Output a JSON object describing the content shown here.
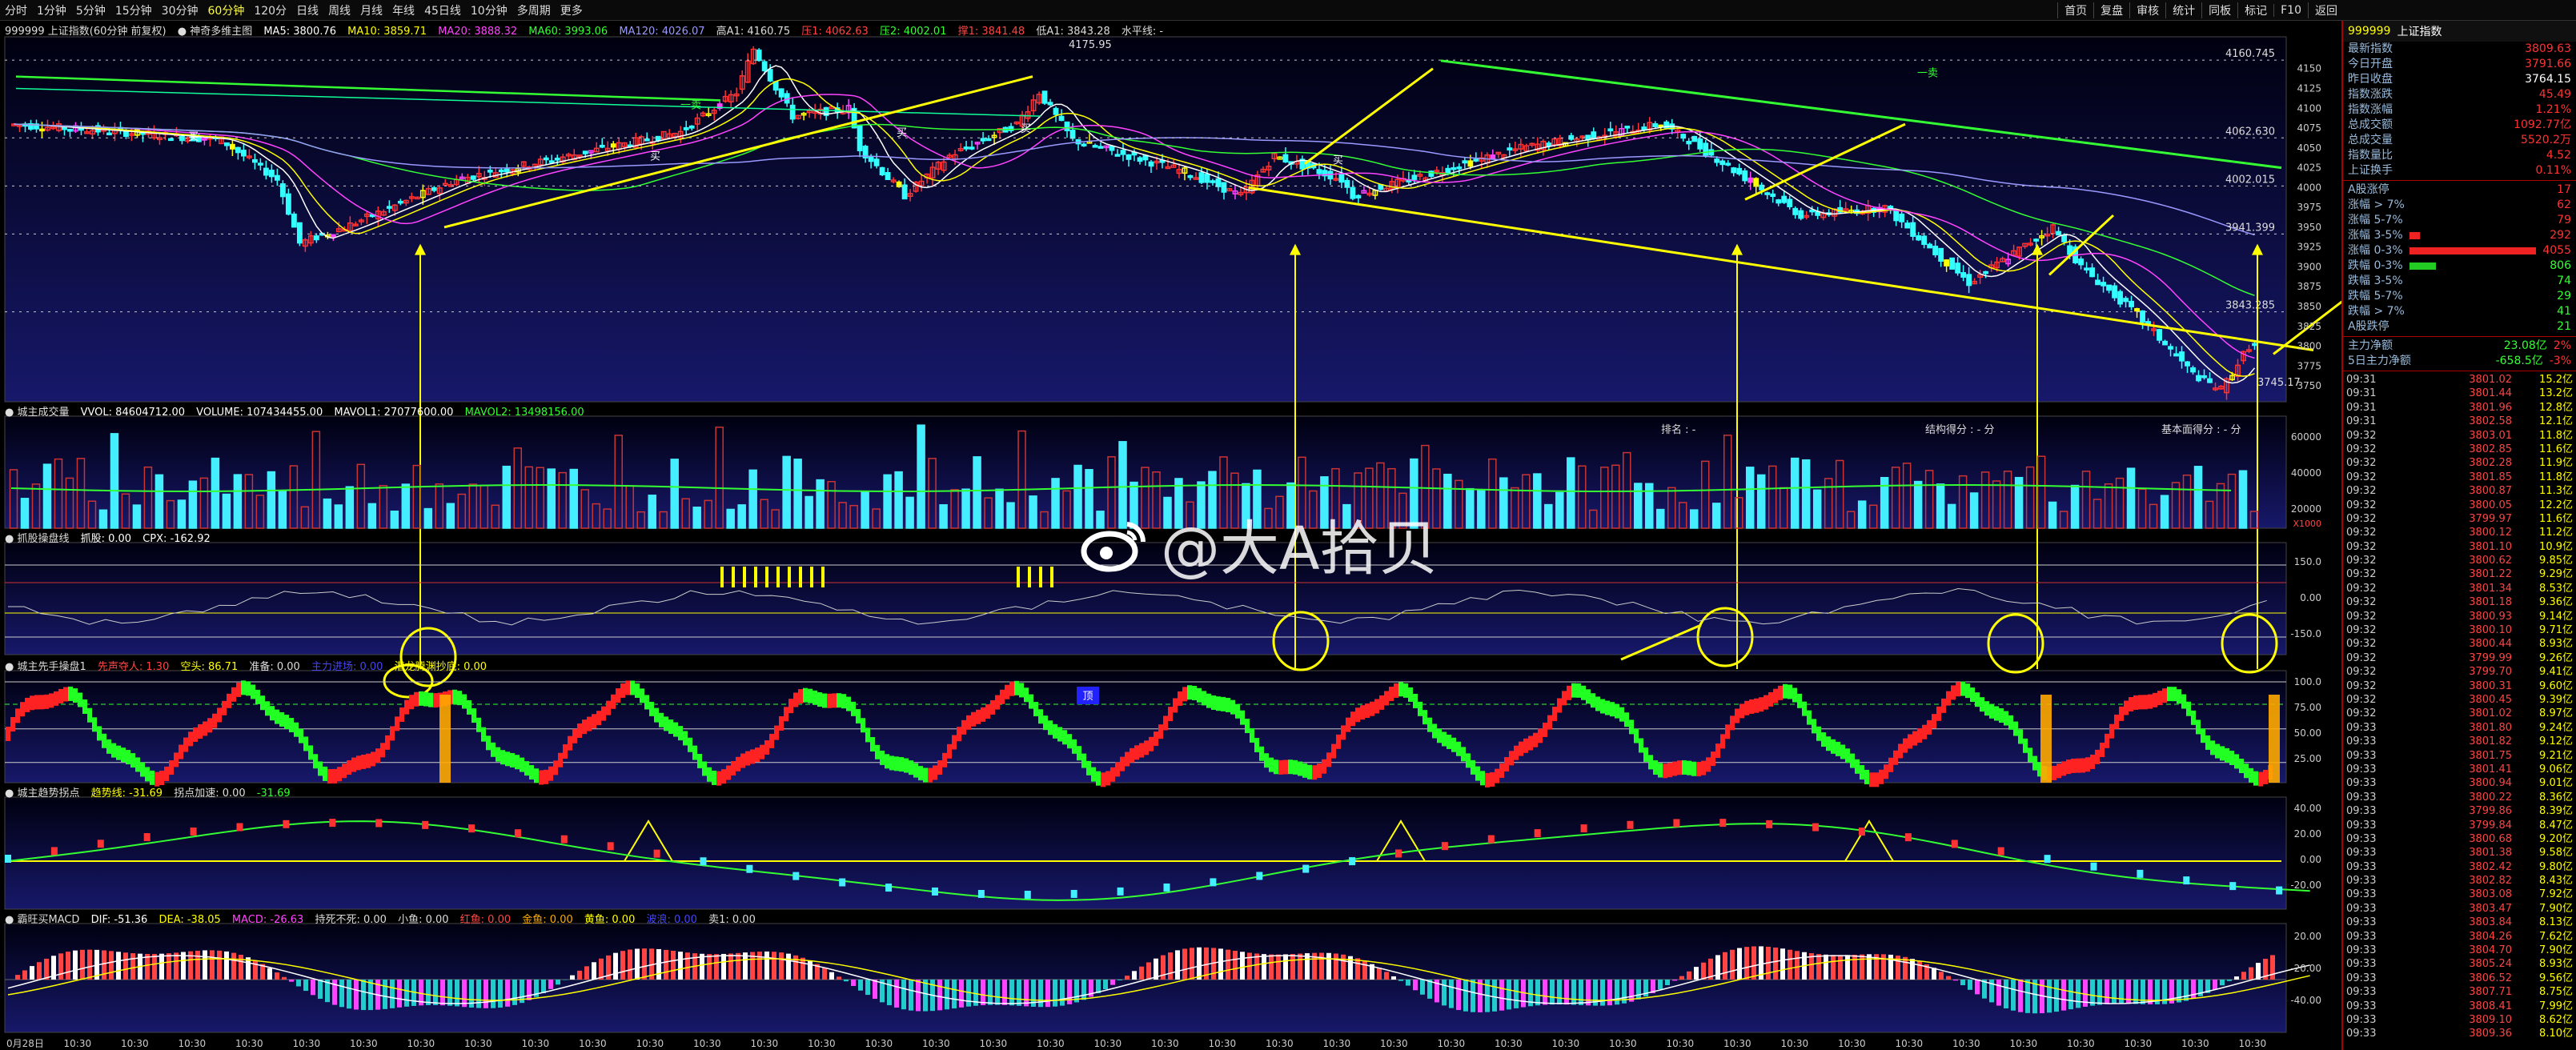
{
  "toolbar": {
    "timeframes": [
      "分时",
      "1分钟",
      "5分钟",
      "15分钟",
      "30分钟",
      "60分钟",
      "120分",
      "日线",
      "周线",
      "月线",
      "年线",
      "45日线",
      "10分钟",
      "多周期",
      "更多"
    ],
    "active_index": 5,
    "right_items": [
      "首页",
      "复盘",
      "审核",
      "统计",
      "同板",
      "标记",
      "F10",
      "返回"
    ]
  },
  "main_panel": {
    "title": "999999 上证指数(60分钟 前复权)",
    "indicator": "● 神奇多维主图",
    "ma": [
      "MA5: 3800.76",
      "MA10: 3859.71",
      "MA20: 3888.32",
      "MA60: 3993.06",
      "MA120: 4026.07"
    ],
    "extra": [
      "高A1: 4160.75",
      "压1: 4062.63",
      "压2: 4002.01",
      "撑1: 3841.48",
      "低A1: 3843.28",
      "水平线: -"
    ],
    "y_labels": [
      "4150",
      "4125",
      "4100",
      "4075",
      "4050",
      "4025",
      "4000",
      "3975",
      "3950",
      "3925",
      "3900",
      "3875",
      "3850",
      "3825",
      "3800",
      "3775",
      "3750"
    ],
    "level_labels": [
      "4160.745",
      "4062.630",
      "4002.015",
      "3941.399",
      "3843.285"
    ],
    "high_label": "4175.95",
    "low_label": "3745.17",
    "buy_label": "买",
    "sell_label": "卖",
    "markers": [
      "一卖",
      "一卖"
    ]
  },
  "volume_panel": {
    "title": "● 城主成交量",
    "values": [
      "VVOL: 84604712.00",
      "VOLUME: 107434455.00",
      "MAVOL1: 27077600.00",
      "MAVOL2: 13498156.00"
    ],
    "labels": [
      "排名 : -",
      "结构得分 : - 分",
      "基本面得分 : - 分"
    ],
    "y_labels": [
      "60000",
      "40000",
      "20000"
    ],
    "unit_label": "X1000"
  },
  "panel3": {
    "title": "● 抓股操盘线",
    "values": [
      "抓股: 0.00",
      "CPX: -162.92"
    ],
    "y_labels": [
      "150.0",
      "0.00",
      "-150.0"
    ]
  },
  "panel4": {
    "title": "● 城主先手操盘1",
    "values": [
      "先声夺人: 1.30",
      "空头: 86.71",
      "准备: 0.00",
      "主力进场: 0.00",
      "潜龙腾渊抄底: 0.00"
    ],
    "y_labels": [
      "100.0",
      "75.00",
      "50.00",
      "25.00"
    ],
    "badge": "顶"
  },
  "panel5": {
    "title": "● 城主趋势拐点",
    "values": [
      "趋势线: -31.69",
      "拐点加速: 0.00",
      "-31.69"
    ],
    "y_labels": [
      "40.00",
      "20.00",
      "0.00",
      "-20.00"
    ]
  },
  "panel6": {
    "title": "● 霸旺买MACD",
    "values": [
      "DIF: -51.36",
      "DEA: -38.05",
      "MACD: -26.63",
      "持死不死: 0.00",
      "小鱼: 0.00",
      "红鱼: 0.00",
      "金鱼: 0.00",
      "黄鱼: 0.00",
      "波浪: 0.00",
      "卖1: 0.00"
    ],
    "y_labels": [
      "20.00",
      "-20.00",
      "-40.00"
    ]
  },
  "time_axis": {
    "first": "0月28日",
    "repeat": "10:30",
    "count": 40
  },
  "watermark": "@大A拾贝",
  "quote": {
    "code": "999999",
    "name": "上证指数",
    "rows": [
      {
        "k": "最新指数",
        "v": "3809.63",
        "c": "v"
      },
      {
        "k": "今日开盘",
        "v": "3791.66",
        "c": "v"
      },
      {
        "k": "昨日收盘",
        "v": "3764.15",
        "c": "w"
      },
      {
        "k": "指数涨跌",
        "v": "45.49",
        "c": "v"
      },
      {
        "k": "指数涨幅",
        "v": "1.21%",
        "c": "v"
      },
      {
        "k": "总成交额",
        "v": "1092.77亿",
        "c": "v"
      },
      {
        "k": "总成交量",
        "v": "5520.2万",
        "c": "v"
      },
      {
        "k": "指数量比",
        "v": "4.52",
        "c": "v"
      },
      {
        "k": "上证换手",
        "v": "0.11%",
        "c": "v"
      }
    ],
    "breadth": [
      {
        "k": "A股涨停",
        "v": "17",
        "c": "v",
        "bar": 0
      },
      {
        "k": "涨幅 > 7%",
        "v": "62",
        "c": "v",
        "bar": 0
      },
      {
        "k": "涨幅 5-7%",
        "v": "79",
        "c": "v",
        "bar": 0
      },
      {
        "k": "涨幅 3-5%",
        "v": "292",
        "c": "v",
        "bar": 0.08
      },
      {
        "k": "涨幅 0-3%",
        "v": "4055",
        "c": "v",
        "bar": 1.0
      },
      {
        "k": "跌幅 0-3%",
        "v": "806",
        "c": "g",
        "bar": 0.2
      },
      {
        "k": "跌幅 3-5%",
        "v": "74",
        "c": "g",
        "bar": 0
      },
      {
        "k": "跌幅 5-7%",
        "v": "29",
        "c": "g",
        "bar": 0
      },
      {
        "k": "跌幅 > 7%",
        "v": "41",
        "c": "g",
        "bar": 0
      },
      {
        "k": "A股跌停",
        "v": "21",
        "c": "g",
        "bar": 0
      }
    ],
    "fund_rows": [
      {
        "k": "主力净额",
        "v": "23.08亿",
        "v2": "2%"
      },
      {
        "k": "5日主力净额",
        "v": "-658.5亿",
        "v2": "-3%"
      }
    ],
    "ticks": [
      [
        "09:31",
        "3801.02",
        "15.2亿"
      ],
      [
        "09:31",
        "3801.44",
        "13.2亿"
      ],
      [
        "09:31",
        "3801.96",
        "12.8亿"
      ],
      [
        "09:31",
        "3802.58",
        "12.1亿"
      ],
      [
        "09:32",
        "3803.01",
        "11.8亿"
      ],
      [
        "09:32",
        "3802.85",
        "11.6亿"
      ],
      [
        "09:32",
        "3802.28",
        "11.9亿"
      ],
      [
        "09:32",
        "3801.85",
        "11.8亿"
      ],
      [
        "09:32",
        "3800.87",
        "11.3亿"
      ],
      [
        "09:32",
        "3800.05",
        "12.2亿"
      ],
      [
        "09:32",
        "3799.97",
        "11.6亿"
      ],
      [
        "09:32",
        "3800.12",
        "11.2亿"
      ],
      [
        "09:32",
        "3801.10",
        "10.9亿"
      ],
      [
        "09:32",
        "3800.62",
        "9.85亿"
      ],
      [
        "09:32",
        "3801.22",
        "9.29亿"
      ],
      [
        "09:32",
        "3801.34",
        "8.53亿"
      ],
      [
        "09:32",
        "3801.18",
        "9.36亿"
      ],
      [
        "09:32",
        "3800.93",
        "9.14亿"
      ],
      [
        "09:32",
        "3800.10",
        "9.71亿"
      ],
      [
        "09:32",
        "3800.44",
        "8.93亿"
      ],
      [
        "09:32",
        "3799.99",
        "9.26亿"
      ],
      [
        "09:32",
        "3799.70",
        "9.41亿"
      ],
      [
        "09:32",
        "3800.31",
        "9.60亿"
      ],
      [
        "09:32",
        "3800.45",
        "9.39亿"
      ],
      [
        "09:32",
        "3801.02",
        "8.97亿"
      ],
      [
        "09:33",
        "3801.80",
        "9.24亿"
      ],
      [
        "09:33",
        "3801.82",
        "9.12亿"
      ],
      [
        "09:33",
        "3801.75",
        "9.21亿"
      ],
      [
        "09:33",
        "3801.41",
        "9.06亿"
      ],
      [
        "09:33",
        "3800.94",
        "9.01亿"
      ],
      [
        "09:33",
        "3800.22",
        "8.36亿"
      ],
      [
        "09:33",
        "3799.86",
        "8.39亿"
      ],
      [
        "09:33",
        "3799.84",
        "8.47亿"
      ],
      [
        "09:33",
        "3800.68",
        "9.20亿"
      ],
      [
        "09:33",
        "3801.38",
        "9.58亿"
      ],
      [
        "09:33",
        "3802.42",
        "9.80亿"
      ],
      [
        "09:33",
        "3802.82",
        "8.43亿"
      ],
      [
        "09:33",
        "3803.08",
        "7.92亿"
      ],
      [
        "09:33",
        "3803.47",
        "7.90亿"
      ],
      [
        "09:33",
        "3803.84",
        "8.13亿"
      ],
      [
        "09:33",
        "3804.26",
        "7.62亿"
      ],
      [
        "09:33",
        "3804.70",
        "7.90亿"
      ],
      [
        "09:33",
        "3805.24",
        "8.93亿"
      ],
      [
        "09:33",
        "3806.52",
        "9.56亿"
      ],
      [
        "09:33",
        "3807.71",
        "8.75亿"
      ],
      [
        "09:33",
        "3808.41",
        "7.99亿"
      ],
      [
        "09:33",
        "3809.10",
        "8.62亿"
      ],
      [
        "09:33",
        "3809.36",
        "8.10亿"
      ]
    ]
  },
  "colors": {
    "up": "#ff3333",
    "down": "#33ffff",
    "yellow": "#ffff00",
    "green": "#33ff33",
    "magenta": "#ff44ff",
    "bg": "#000000",
    "panel_bg": "#070a2a"
  }
}
